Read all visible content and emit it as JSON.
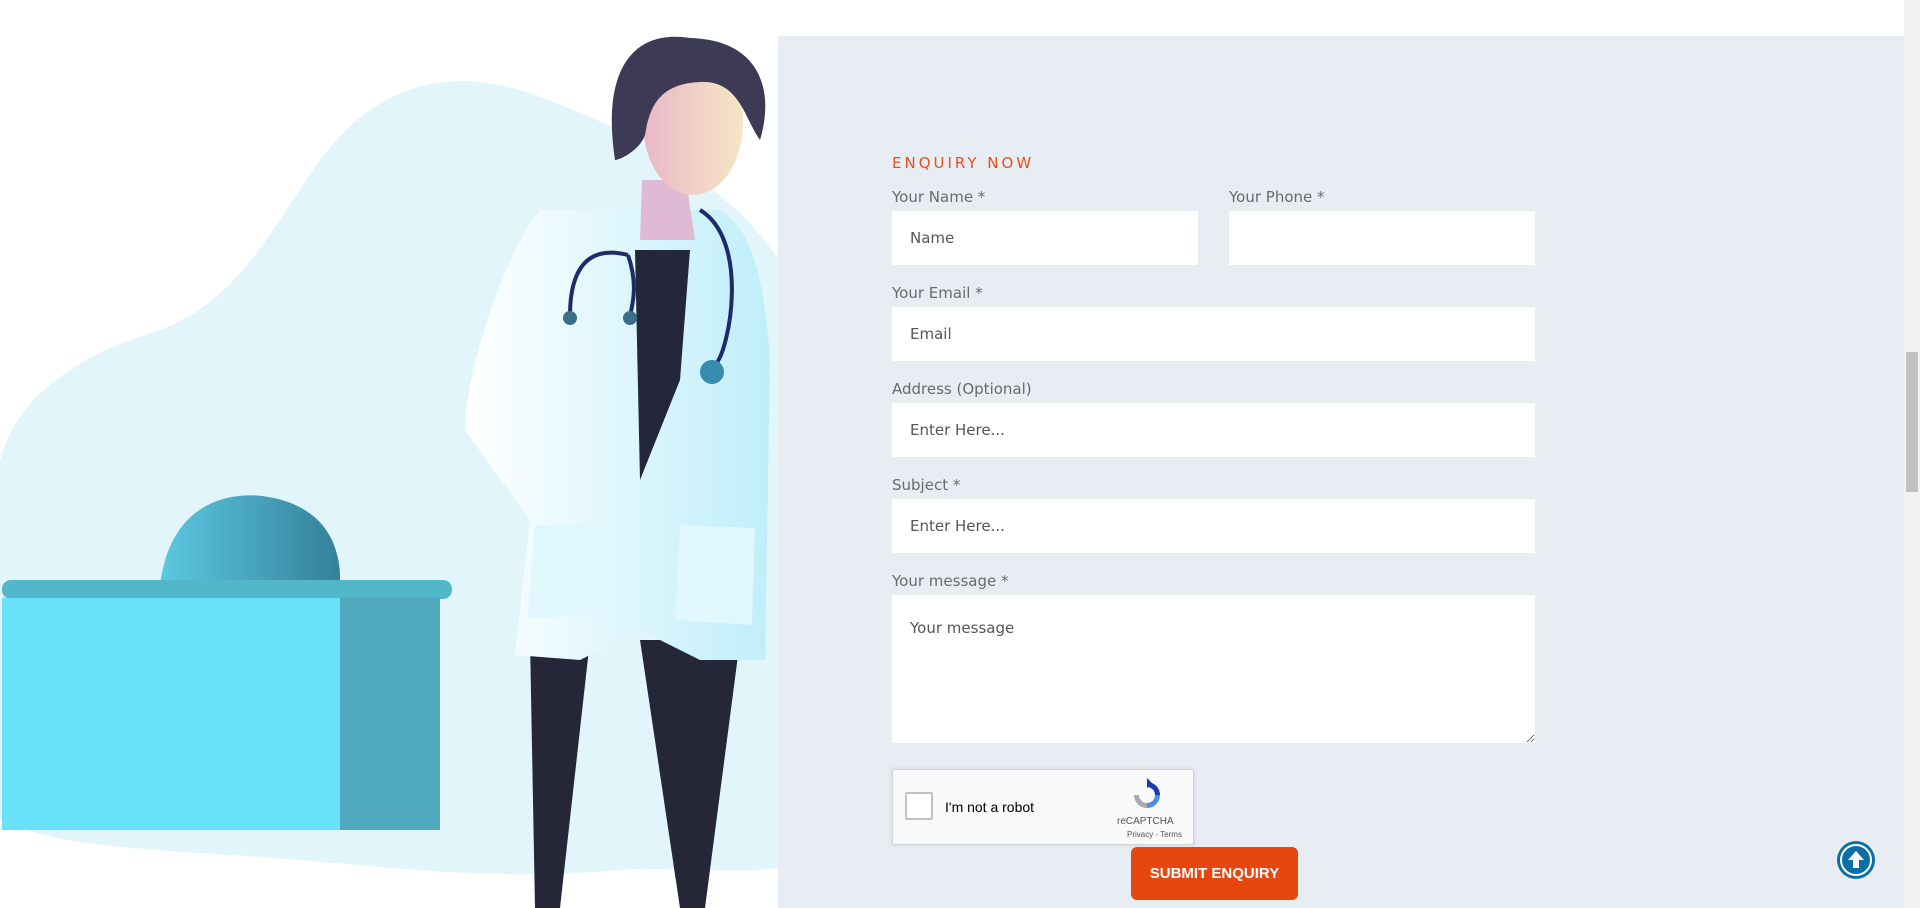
{
  "enquiry": {
    "section_title": "ENQUIRY NOW",
    "name": {
      "label": "Your Name *",
      "placeholder": "Name",
      "value": ""
    },
    "phone": {
      "label": "Your Phone *",
      "placeholder": "",
      "value": ""
    },
    "email": {
      "label": "Your Email *",
      "placeholder": "Email",
      "value": ""
    },
    "address": {
      "label": "Address (Optional)",
      "placeholder": "Enter Here...",
      "value": ""
    },
    "subject": {
      "label": "Subject *",
      "placeholder": "Enter Here...",
      "value": ""
    },
    "message": {
      "label": "Your message *",
      "placeholder": "Your message",
      "value": ""
    },
    "submit_label": "SUBMIT ENQUIRY"
  },
  "recaptcha": {
    "label": "I'm not a robot",
    "brand": "reCAPTCHA",
    "links": "Privacy - Terms",
    "checked": false
  },
  "icons": {
    "back_to_top": "arrow-up-icon",
    "recaptcha_logo": "recaptcha-logo-icon"
  },
  "colors": {
    "accent": "#e8460f",
    "section_title": "#e8501a",
    "panel_bg": "#e8ecf3",
    "back_to_top_bg": "#0b6fa4"
  }
}
